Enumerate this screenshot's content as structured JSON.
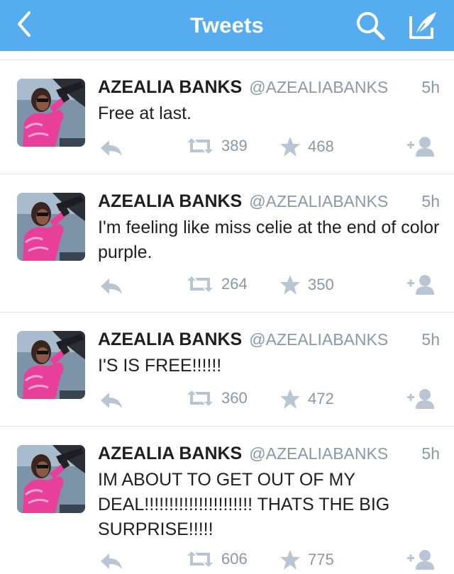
{
  "navbar": {
    "title": "Tweets",
    "back_icon": "chevron-left-icon",
    "search_icon": "search-icon",
    "compose_icon": "compose-quill-icon",
    "background": "#55acee"
  },
  "colors": {
    "meta_gray": "#8899a6",
    "icon_gray": "#b8c6d3",
    "divider": "#e1e8ed"
  },
  "tweets": [
    {
      "name": "AZEALIA BANKS",
      "handle": "@AZEALIABANKS",
      "time": "5h",
      "text": "Free at last.",
      "retweets": "389",
      "favorites": "468"
    },
    {
      "name": "AZEALIA BANKS",
      "handle": "@AZEALIABANKS",
      "time": "5h",
      "text": "I'm feeling like miss celie at the end of color purple.",
      "retweets": "264",
      "favorites": "350"
    },
    {
      "name": "AZEALIA BANKS",
      "handle": "@AZEALIABANKS",
      "time": "5h",
      "text": "I'S IS FREE!!!!!!",
      "retweets": "360",
      "favorites": "472"
    },
    {
      "name": "AZEALIA BANKS",
      "handle": "@AZEALIABANKS",
      "time": "5h",
      "text": "IM ABOUT TO GET OUT OF MY DEAL!!!!!!!!!!!!!!!!!!!!!! THATS THE BIG SURPRISE!!!!!",
      "retweets": "606",
      "favorites": "775"
    }
  ]
}
